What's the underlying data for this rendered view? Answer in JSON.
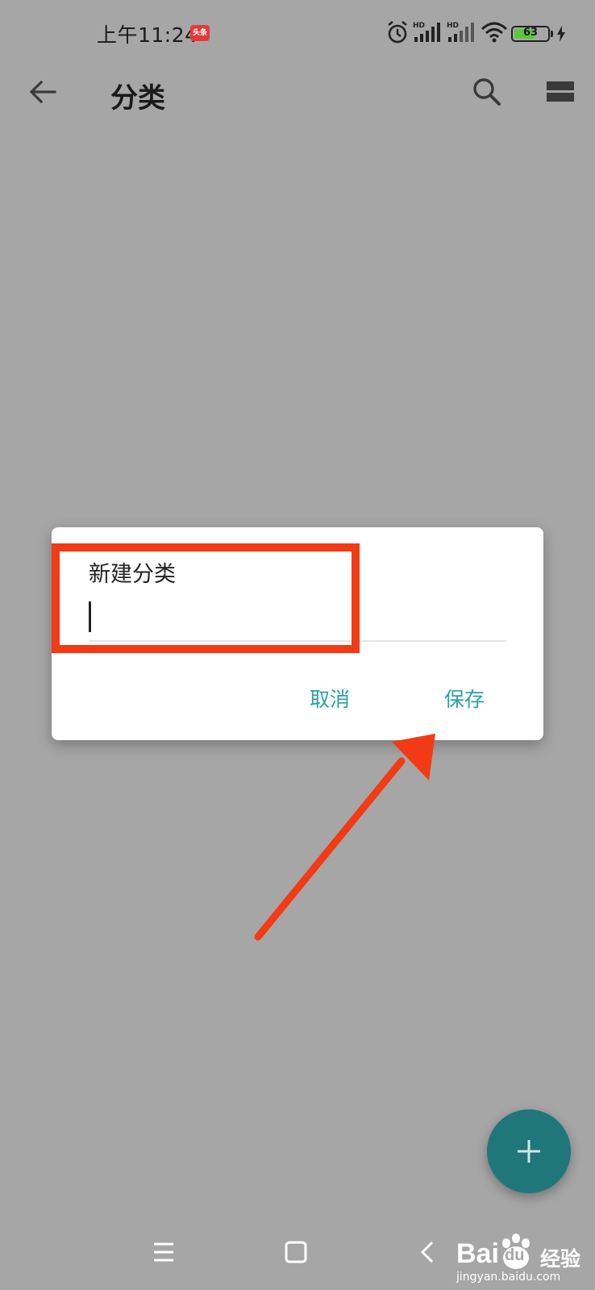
{
  "status_bar": {
    "time": "上午11:24",
    "notification_badge": "头条",
    "battery_level": "63",
    "battery_fraction": 0.63,
    "icons": [
      "alarm-icon",
      "signal-hd-icon",
      "signal-hd-icon",
      "wifi-icon",
      "battery-icon",
      "charging-icon"
    ]
  },
  "app_bar": {
    "title": "分类",
    "icons": [
      "back-arrow-icon",
      "search-icon",
      "view-toggle-icon"
    ]
  },
  "dialog": {
    "title": "新建分类",
    "input_value": "",
    "cancel_label": "取消",
    "save_label": "保存"
  },
  "colors": {
    "accent": "#2aa3a6",
    "fab": "#20777a",
    "annotation": "#f23a14",
    "scrim": "#a6a6a6"
  },
  "watermark": {
    "brand_latin": "Bai",
    "brand_du": "du",
    "brand_cn": "经验",
    "url": "jingyan.baidu.com"
  }
}
